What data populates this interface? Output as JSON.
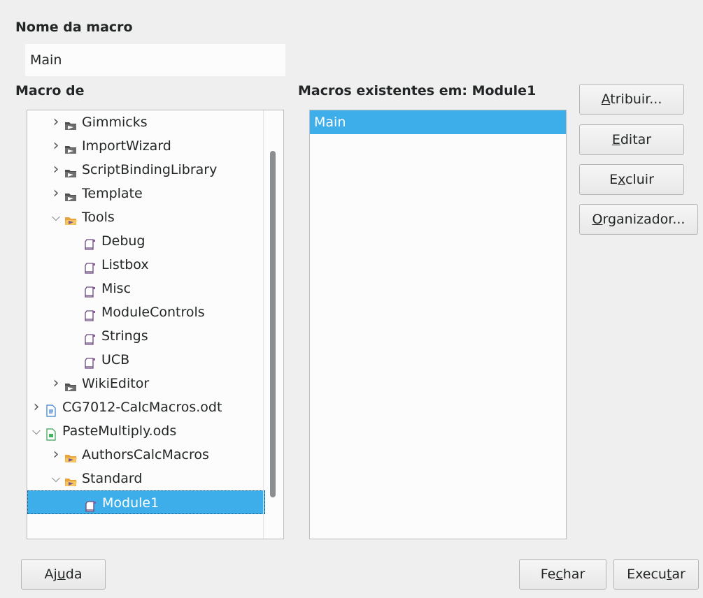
{
  "macro_name": {
    "label": "Nome da macro",
    "value": "Main"
  },
  "macro_from": {
    "label": "Macro de",
    "tree": [
      {
        "label": "Gimmicks",
        "icon": "library-icon",
        "expander": "collapsed"
      },
      {
        "label": "ImportWizard",
        "icon": "library-icon",
        "expander": "collapsed"
      },
      {
        "label": "ScriptBindingLibrary",
        "icon": "library-icon",
        "expander": "collapsed"
      },
      {
        "label": "Template",
        "icon": "library-icon",
        "expander": "collapsed"
      },
      {
        "label": "Tools",
        "icon": "open-library-icon",
        "expander": "expanded"
      },
      {
        "label": "Debug",
        "icon": "module-icon",
        "expander": "none"
      },
      {
        "label": "Listbox",
        "icon": "module-icon",
        "expander": "none"
      },
      {
        "label": "Misc",
        "icon": "module-icon",
        "expander": "none"
      },
      {
        "label": "ModuleControls",
        "icon": "module-icon",
        "expander": "none"
      },
      {
        "label": "Strings",
        "icon": "module-icon",
        "expander": "none"
      },
      {
        "label": "UCB",
        "icon": "module-icon",
        "expander": "none"
      },
      {
        "label": "WikiEditor",
        "icon": "library-icon",
        "expander": "collapsed"
      },
      {
        "label": "CG7012-CalcMacros.odt",
        "icon": "writer-doc-icon",
        "expander": "collapsed"
      },
      {
        "label": "PasteMultiply.ods",
        "icon": "calc-doc-icon",
        "expander": "expanded"
      },
      {
        "label": "AuthorsCalcMacros",
        "icon": "open-library-icon",
        "expander": "collapsed"
      },
      {
        "label": "Standard",
        "icon": "open-library-icon",
        "expander": "expanded"
      },
      {
        "label": "Module1",
        "icon": "module-icon",
        "expander": "none",
        "selected": true
      }
    ]
  },
  "existing": {
    "label": "Macros existentes em: Module1",
    "items": [
      {
        "label": "Main",
        "selected": true
      }
    ]
  },
  "buttons": {
    "assign": {
      "pre": "",
      "u": "A",
      "post": "tribuir..."
    },
    "edit": {
      "pre": "",
      "u": "E",
      "post": "ditar"
    },
    "delete": {
      "pre": "E",
      "u": "x",
      "post": "cluir"
    },
    "organizer": {
      "pre": "",
      "u": "O",
      "post": "rganizador..."
    },
    "help": {
      "pre": "Aj",
      "u": "u",
      "post": "da"
    },
    "close": {
      "pre": "Fe",
      "u": "c",
      "post": "har"
    },
    "run": {
      "pre": "Execu",
      "u": "t",
      "post": "ar"
    }
  },
  "colors": {
    "selection": "#3daee9",
    "window_bg": "#efefef",
    "field_bg": "#fcfcfc"
  }
}
